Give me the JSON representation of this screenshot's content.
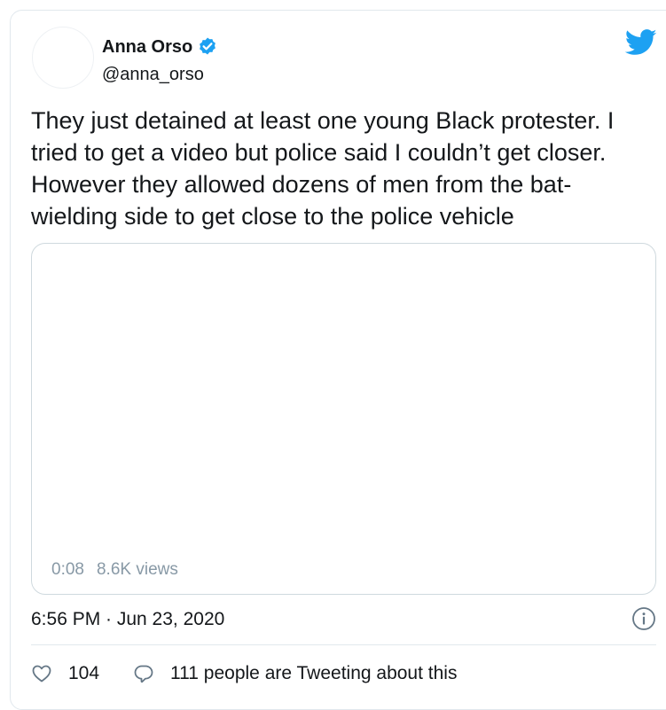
{
  "user": {
    "display_name": "Anna Orso",
    "handle": "@anna_orso",
    "verified": true
  },
  "tweet": {
    "text": "They just detained at least one young Black protester. I tried to get a video but police said I couldn’t get closer. However they allowed dozens of men from the bat-wielding side to get close to the police vehicle",
    "timestamp": "6:56 PM · Jun 23, 2020"
  },
  "media": {
    "duration": "0:08",
    "views": "8.6K views"
  },
  "engagement": {
    "likes": "104",
    "tweeting_about": "111 people are Tweeting about this"
  },
  "icons": {
    "brand": "twitter-bird-icon",
    "verified": "verified-badge-icon",
    "info": "info-icon",
    "like": "heart-icon",
    "reply": "speech-bubble-icon"
  },
  "colors": {
    "brand_blue": "#1da1f2",
    "text": "#14171a",
    "muted": "#8899a6",
    "border": "#e1e8ed"
  }
}
